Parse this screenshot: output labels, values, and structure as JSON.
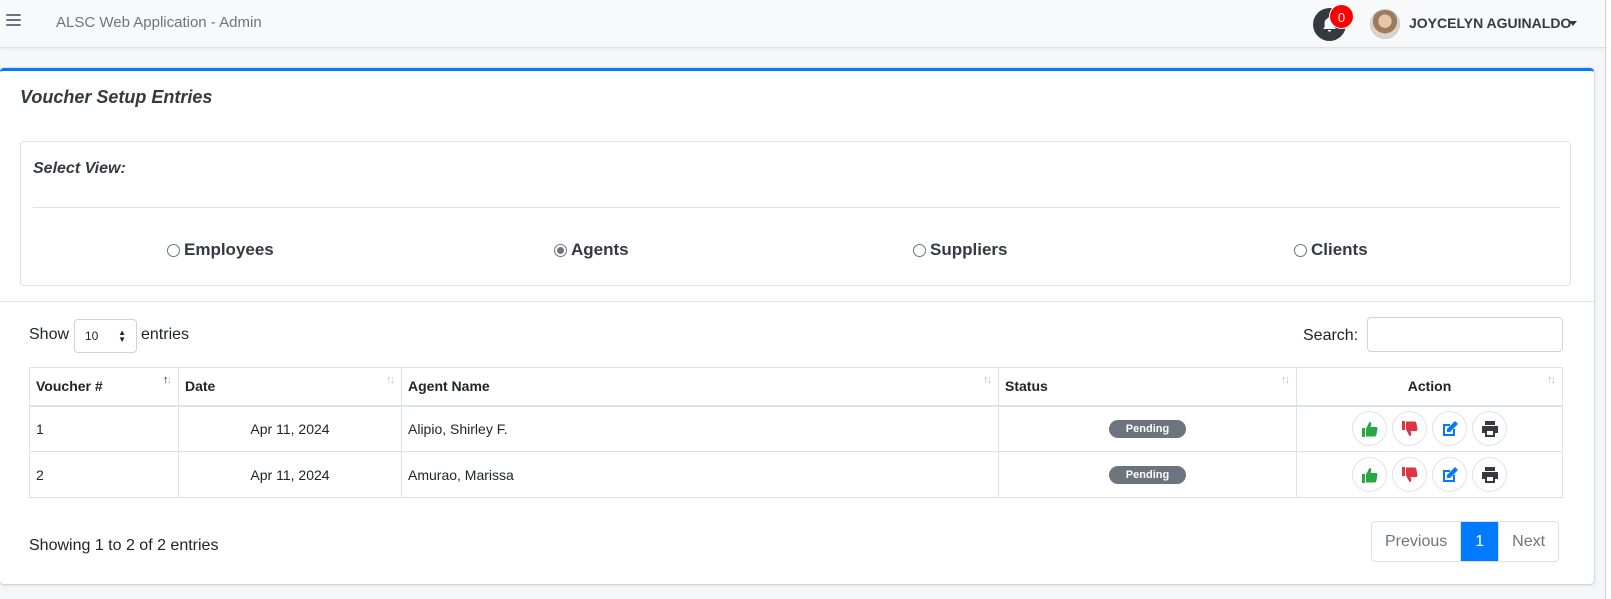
{
  "navbar": {
    "app_title": "ALSC Web Application - Admin",
    "notification_count": "0",
    "user_name": "JOYCELYN AGUINALDO"
  },
  "card": {
    "title": "Voucher Setup Entries",
    "select_view_label": "Select View:",
    "view_options": [
      {
        "label": "Employees",
        "checked": false
      },
      {
        "label": "Agents",
        "checked": true
      },
      {
        "label": "Suppliers",
        "checked": false
      },
      {
        "label": "Clients",
        "checked": false
      }
    ]
  },
  "table_controls": {
    "show_label": "Show",
    "page_size": "10",
    "entries_label": "entries",
    "search_label": "Search:",
    "search_value": ""
  },
  "table": {
    "headers": [
      "Voucher #",
      "Date",
      "Agent Name",
      "Status",
      "Action"
    ],
    "rows": [
      {
        "voucher": "1",
        "date": "Apr 11, 2024",
        "agent": "Alipio, Shirley F.",
        "status": "Pending"
      },
      {
        "voucher": "2",
        "date": "Apr 11, 2024",
        "agent": "Amurao, Marissa",
        "status": "Pending"
      }
    ]
  },
  "footer": {
    "info": "Showing 1 to 2 of 2 entries",
    "previous_label": "Previous",
    "current_page": "1",
    "next_label": "Next"
  },
  "icons": {
    "approve": "thumbs-up-icon",
    "reject": "thumbs-down-icon",
    "edit": "edit-icon",
    "print": "print-icon"
  },
  "colors": {
    "accent": "#007bff",
    "approve": "#28a745",
    "reject": "#dc3545",
    "badge": "#6c757d",
    "notification": "#ff0000"
  }
}
